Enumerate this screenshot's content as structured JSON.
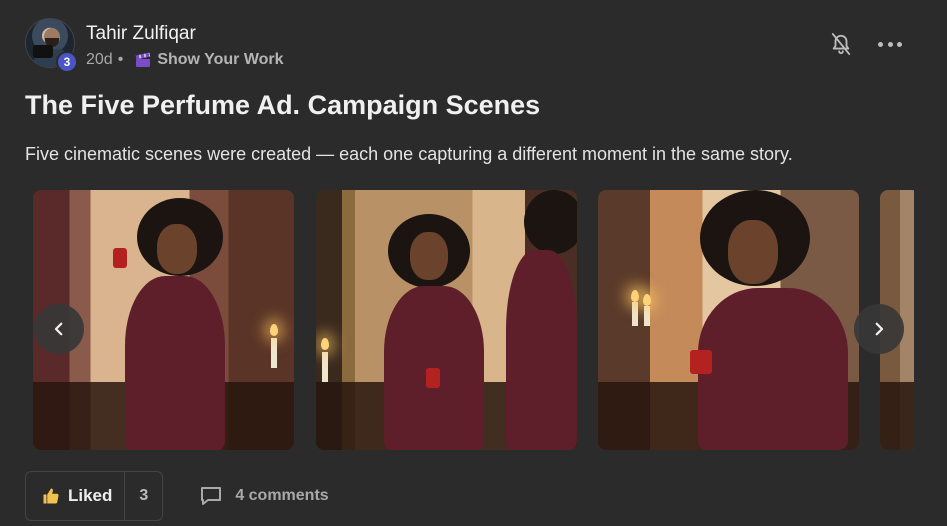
{
  "author": {
    "name": "Tahir Zulfiqar",
    "level": "3",
    "time_ago": "20d",
    "separator": "•",
    "category": "Show Your Work",
    "category_icon": "clapperboard-icon"
  },
  "post": {
    "title": "The Five Perfume Ad. Campaign Scenes",
    "body": "Five cinematic scenes were created — each one capturing a different moment in the same story."
  },
  "carousel": {
    "slides": [
      {
        "label": "Woman in robe holding perfume bottle by window"
      },
      {
        "label": "Woman in robe reflected in mirror holding perfume"
      },
      {
        "label": "Woman smiling holding red Supreme perfume bottle"
      },
      {
        "label": "Partial view of next scene"
      }
    ],
    "prev_icon": "chevron-left-icon",
    "next_icon": "chevron-right-icon"
  },
  "actions": {
    "like_label": "Liked",
    "like_count": "3",
    "comments_label": "4 comments"
  },
  "colors": {
    "background": "#2b2b2b",
    "badge": "#4a55c8",
    "like_icon": "#f2c24e"
  }
}
